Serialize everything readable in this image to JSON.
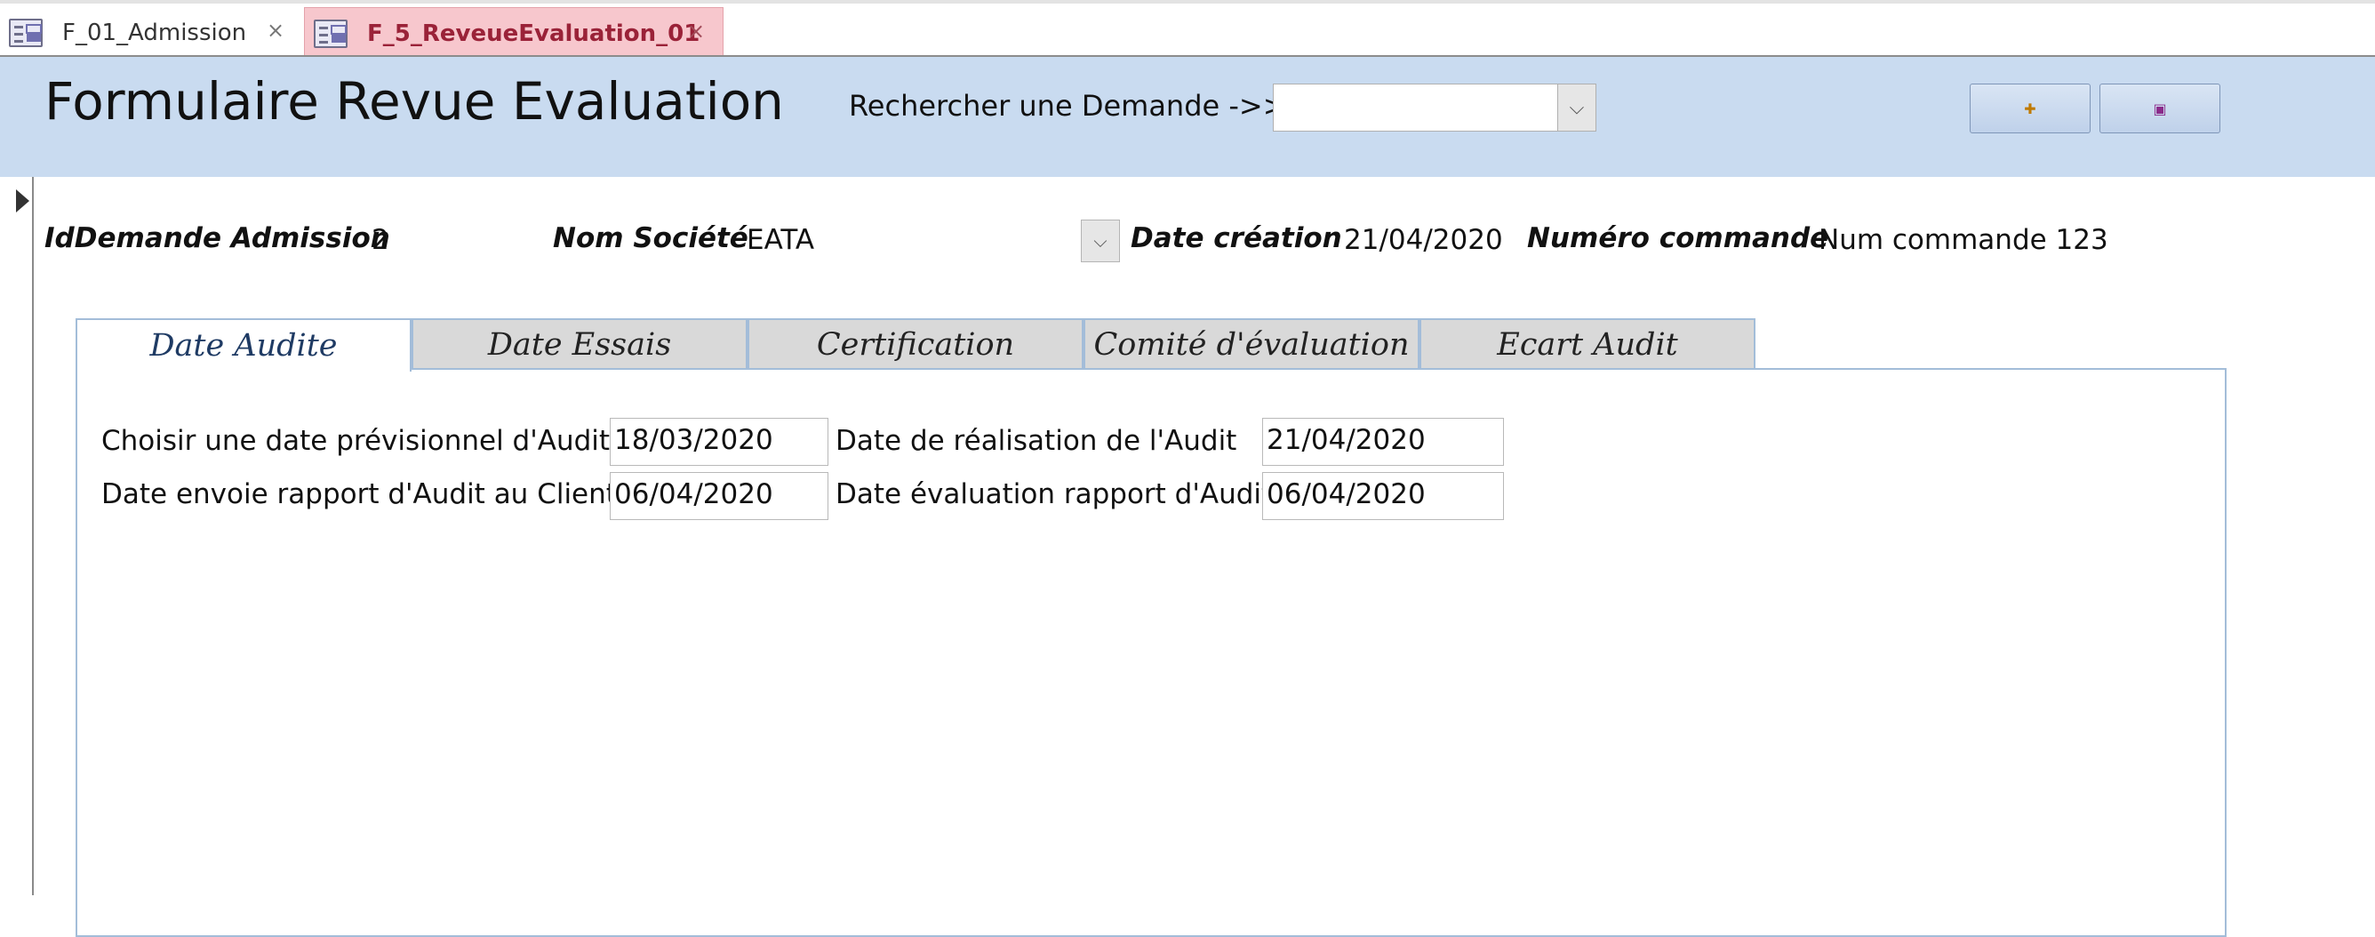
{
  "tabs": [
    {
      "label": "F_01_Admission",
      "icon": "form-icon",
      "close": "×",
      "active": false
    },
    {
      "label": "F_5_ReveueEvaluation_01",
      "icon": "form-icon",
      "close": "×",
      "active": true
    }
  ],
  "header": {
    "title": "Formulaire Revue Evaluation",
    "search_label": "Rechercher une Demande ->>",
    "search_value": "",
    "dropdown_glyph": "⌵",
    "buttons": [
      {
        "name": "new-record-button",
        "icon": "new-record-icon",
        "glyph": "✚"
      },
      {
        "name": "save-record-button",
        "icon": "save-icon",
        "glyph": "▣"
      }
    ],
    "background": "#c9dbf0"
  },
  "record": {
    "id_label": "IdDemande Admission",
    "id_value": "2",
    "societe_label": "Nom Société",
    "societe_value": "EATA",
    "date_creation_label": "Date création",
    "date_creation_value": "21/04/2020",
    "numero_label": "Numéro commande",
    "numero_value": "Num commande 123"
  },
  "page_tabs": [
    "Date Audite",
    "Date Essais",
    "Certification",
    "Comité d'évaluation",
    "Ecart Audit"
  ],
  "active_page_tab": "Date Audite",
  "audit": {
    "prev_label": "Choisir une date prévisionnel d'Audit",
    "prev_value": "18/03/2020",
    "real_label": "Date de réalisation de l'Audit",
    "real_value": "21/04/2020",
    "envoi_label": "Date envoie rapport d'Audit au Client",
    "envoi_value": "06/04/2020",
    "eval_label": "Date évaluation rapport d'Audit",
    "eval_value": "06/04/2020"
  }
}
